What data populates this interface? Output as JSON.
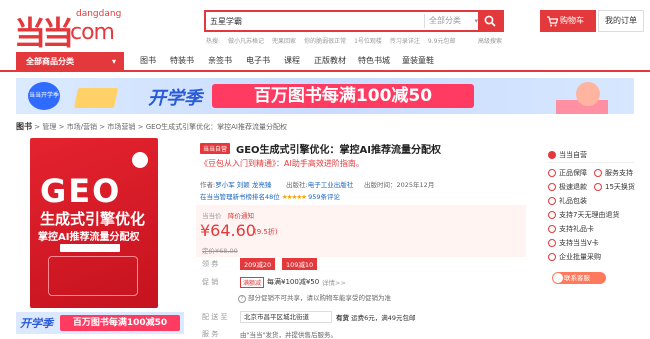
{
  "header": {
    "logo_glyph": "当当",
    "brand_top": "dangdang",
    "brand_bottom": ".com",
    "search_value": "五星学霸",
    "search_category": "全部分类",
    "hotwords": [
      "热搜:",
      "做小凡苏格记",
      "兜果回家",
      "你的脆弱很正常",
      "1号位观楼",
      "传习录详注",
      "9.9元包邮"
    ],
    "advanced_search": "高级搜索",
    "cart_label": "购物车",
    "order_label": "我的订单"
  },
  "nav": {
    "all_categories": "全部商品分类",
    "items": [
      "图书",
      "特装书",
      "亲签书",
      "电子书",
      "课程",
      "正版教材",
      "特色书城",
      "童装童鞋"
    ]
  },
  "banner": {
    "badge": "当当开学季",
    "title": "开学季",
    "promo": "百万图书每满100减50"
  },
  "breadcrumb": {
    "root": "图书",
    "path": [
      "管理",
      "市场/营销",
      "市场营销"
    ],
    "current": "GEO生成式引擎优化：掌控AI推荐流量分配权",
    "sep": ">"
  },
  "cover": {
    "line1": "GEO",
    "line2": "生成式引擎优化",
    "line3": "掌控AI推荐流量分配权"
  },
  "side_banner": {
    "title": "开学季",
    "promo": "百万图书每满100减50"
  },
  "product": {
    "self_badge": "当当自营",
    "title": "GEO生成式引擎优化：掌控AI推荐流量分配权",
    "subtitle": "《豆包从入门到精通》：AI助手高效进阶指南。",
    "author_label": "作者:",
    "author": "罗小军 刘颖 龙亮臻",
    "publisher_label": "出版社:",
    "publisher": "电子工业出版社",
    "pubdate": "出版时间：2025年12月",
    "rank_text": "在当当管理新书榜排名48位",
    "stars": "★★★★★",
    "reviews": "959条评论",
    "price_label": "当当价",
    "price_notice": "降价通知",
    "price": "¥64.60",
    "discount": "(9.5折)",
    "orig_price": "定价¥68.00",
    "coupon_label": "领 券",
    "coupons": [
      "209减20",
      "109减10"
    ],
    "promo_label": "促 销",
    "promo_tag": "满额减",
    "promo_text": "每满¥100减¥50",
    "promo_detail": "详情>>",
    "promo_note": "部分促销不可共享，请以购物车能享受的促销为准",
    "delivery_label": "配 送 至",
    "address": "北京市昌平区城北街道",
    "stock": "有货",
    "shipping": "运费6元，满49元包邮",
    "service_label": "服 务",
    "service": "由\"当当\"发货，并提供售后服务。"
  },
  "side_info": {
    "head": "当当自营",
    "items": [
      "正品保障",
      "服务支持",
      "极速退款",
      "15天换货",
      "礼品包装",
      "支持7天无理由退货",
      "支持礼品卡",
      "支持当当V卡",
      "企业批量采购"
    ],
    "shop_button": "联系客服"
  },
  "colors": {
    "accent": "#e4393c",
    "promo": "#ff3b62",
    "banner_bg": "#dbeaff"
  }
}
